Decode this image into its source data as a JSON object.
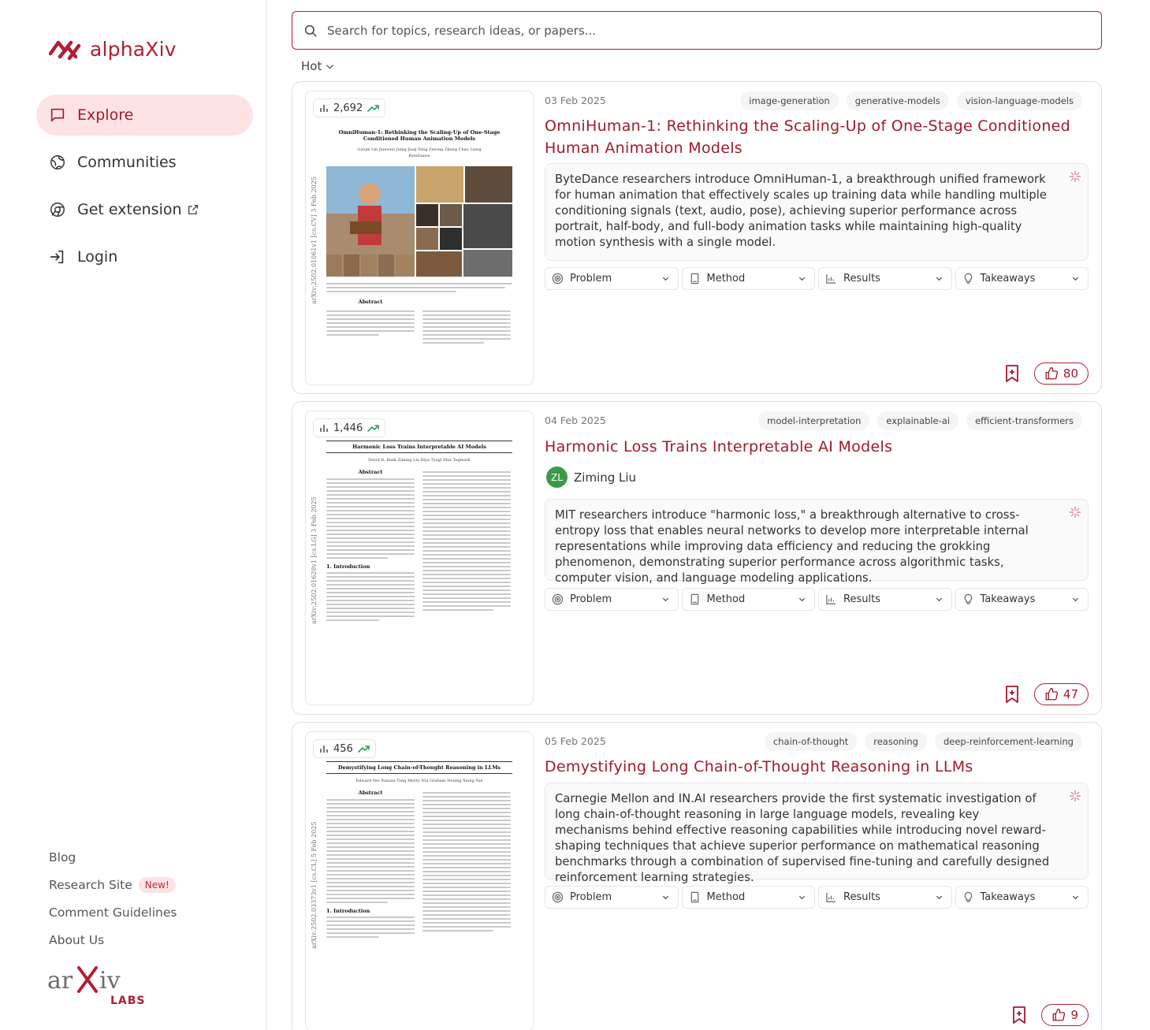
{
  "app": {
    "name": "alphaXiv"
  },
  "nav": [
    {
      "label": "Explore",
      "icon": "chat-icon"
    },
    {
      "label": "Communities",
      "icon": "globe-icon"
    },
    {
      "label": "Get extension",
      "icon": "chrome-icon"
    },
    {
      "label": "Login",
      "icon": "login-icon"
    }
  ],
  "footer": {
    "blog": "Blog",
    "research_site": "Research Site",
    "new_badge": "New!",
    "comment_guidelines": "Comment Guidelines",
    "about": "About Us",
    "labs": "LABS"
  },
  "search": {
    "placeholder": "Search for topics, research ideas, or papers..."
  },
  "sort": {
    "label": "Hot"
  },
  "colors": {
    "accent": "#a11a2c",
    "accent_soft": "#fde3e3",
    "avatar_green": "#3a9a48",
    "trend_green": "#2ea44f"
  },
  "papers": [
    {
      "views": "2,692",
      "date": "03 Feb 2025",
      "tags": [
        "image-generation",
        "generative-models",
        "vision-language-models"
      ],
      "title": "OmniHuman-1: Rethinking the Scaling-Up of One-Stage Conditioned Human Animation Models",
      "summary": "ByteDance researchers introduce OmniHuman-1, a breakthrough unified framework for human animation that effectively scales up training data while handling multiple conditioning signals (text, audio, pose), achieving superior performance across portrait, half-body, and full-body animation tasks while maintaining high-quality motion synthesis with a single model.",
      "likes": "80",
      "thumb_title": "OmniHuman-1: Rethinking the Scaling-Up of One-Stage Conditioned Human Animation Models",
      "thumb_authors": "Gaojie Lin  Jianwen Jiang  Jiaqi Yang  Zerong Zheng  Chao Liang",
      "thumb_org": "ByteDance",
      "thumb_id": "arXiv:2502.01061v1  [cs.CV]  3 Feb 2025",
      "thumb_section": "Abstract"
    },
    {
      "views": "1,446",
      "date": "04 Feb 2025",
      "tags": [
        "model-interpretation",
        "explainable-ai",
        "efficient-transformers"
      ],
      "title": "Harmonic Loss Trains Interpretable AI Models",
      "author_initials": "ZL",
      "author_name": "Ziming Liu",
      "summary": "MIT researchers introduce \"harmonic loss,\" a breakthrough alternative to cross-entropy loss that enables neural networks to develop more interpretable internal representations while improving data efficiency and reducing the grokking phenomenon, demonstrating superior performance across algorithmic tasks, computer vision, and language modeling applications.",
      "likes": "47",
      "thumb_title": "Harmonic Loss Trains Interpretable AI Models",
      "thumb_authors": "David D. Baek  Ziming Liu  Riya Tyagi  Max Tegmark",
      "thumb_id": "arXiv:2502.01628v1  [cs.LG]  3 Feb 2025",
      "thumb_section": "Abstract",
      "thumb_section2": "1. Introduction"
    },
    {
      "views": "456",
      "date": "05 Feb 2025",
      "tags": [
        "chain-of-thought",
        "reasoning",
        "deep-reinforcement-learning"
      ],
      "title": "Demystifying Long Chain-of-Thought Reasoning in LLMs",
      "summary": "Carnegie Mellon and IN.AI researchers provide the first systematic investigation of long chain-of-thought reasoning in large language models, revealing key mechanisms behind effective reasoning capabilities while introducing novel reward-shaping techniques that achieve superior performance on mathematical reasoning benchmarks through a combination of supervised fine-tuning and carefully designed reinforcement learning strategies.",
      "likes": "9",
      "thumb_title": "Demystifying Long Chain-of-Thought Reasoning in LLMs",
      "thumb_authors": "Edward Yeo  Yuxuan Tong  Morry Niu  Graham Neubig  Xiang Yue",
      "thumb_id": "arXiv:2502.03373v1  [cs.CL]  5 Feb 2025",
      "thumb_section": "Abstract",
      "thumb_section2": "1. Introduction"
    }
  ],
  "sections": {
    "problem": "Problem",
    "method": "Method",
    "results": "Results",
    "takeaways": "Takeaways"
  }
}
